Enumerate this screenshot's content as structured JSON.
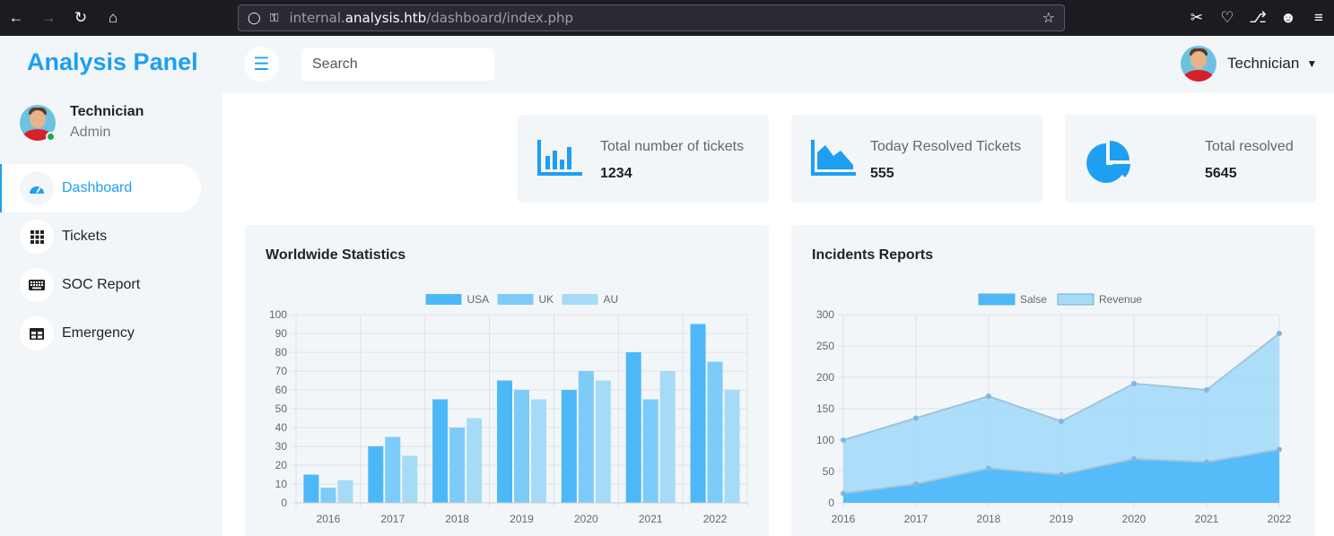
{
  "browser": {
    "url_prefix": "internal.",
    "url_domain": "analysis.htb",
    "url_path": "/dashboard/index.php"
  },
  "sidebar": {
    "brand": "Analysis Panel",
    "user": {
      "name": "Technician",
      "role": "Admin"
    },
    "items": [
      {
        "label": "Dashboard",
        "icon": "dashboard-gauge-icon",
        "active": true
      },
      {
        "label": "Tickets",
        "icon": "grid-icon",
        "active": false
      },
      {
        "label": "SOC Report",
        "icon": "keyboard-icon",
        "active": false
      },
      {
        "label": "Emergency",
        "icon": "table-icon",
        "active": false
      }
    ]
  },
  "topbar": {
    "search_placeholder": "Search",
    "user_name": "Technician"
  },
  "stats": [
    {
      "title": "Total number of tickets",
      "value": "1234",
      "icon": "bar-chart-icon"
    },
    {
      "title": "Today Resolved Tickets",
      "value": "555",
      "icon": "area-chart-icon"
    },
    {
      "title": "Total resolved",
      "value": "5645",
      "icon": "pie-chart-icon"
    }
  ],
  "colors": {
    "accent": "#1e9ff2",
    "usa": "#4db8f8",
    "uk": "#7dcbf8",
    "au": "#a6dbf8"
  },
  "chart_data": [
    {
      "type": "bar",
      "title": "Worldwide Statistics",
      "categories": [
        "2016",
        "2017",
        "2018",
        "2019",
        "2020",
        "2021",
        "2022"
      ],
      "series": [
        {
          "name": "USA",
          "values": [
            15,
            30,
            55,
            65,
            60,
            80,
            95
          ],
          "color": "#4db8f8"
        },
        {
          "name": "UK",
          "values": [
            8,
            35,
            40,
            60,
            70,
            55,
            75
          ],
          "color": "#7dcbf8"
        },
        {
          "name": "AU",
          "values": [
            12,
            25,
            45,
            55,
            65,
            70,
            60
          ],
          "color": "#a6dbf8"
        }
      ],
      "ylim": [
        0,
        100
      ],
      "yticks": [
        0,
        10,
        20,
        30,
        40,
        50,
        60,
        70,
        80,
        90,
        100
      ],
      "grid": true,
      "legend": "top-center"
    },
    {
      "type": "area",
      "title": "Incidents Reports",
      "categories": [
        "2016",
        "2017",
        "2018",
        "2019",
        "2020",
        "2021",
        "2022"
      ],
      "series": [
        {
          "name": "Salse",
          "values": [
            15,
            30,
            55,
            45,
            70,
            65,
            85
          ],
          "color": "#4db8f8"
        },
        {
          "name": "Revenue",
          "values": [
            100,
            135,
            170,
            130,
            190,
            180,
            270
          ],
          "color": "#a6dbf8"
        }
      ],
      "ylim": [
        0,
        300
      ],
      "yticks": [
        0,
        50,
        100,
        150,
        200,
        250,
        300
      ],
      "grid": true,
      "legend": "top-center"
    }
  ]
}
